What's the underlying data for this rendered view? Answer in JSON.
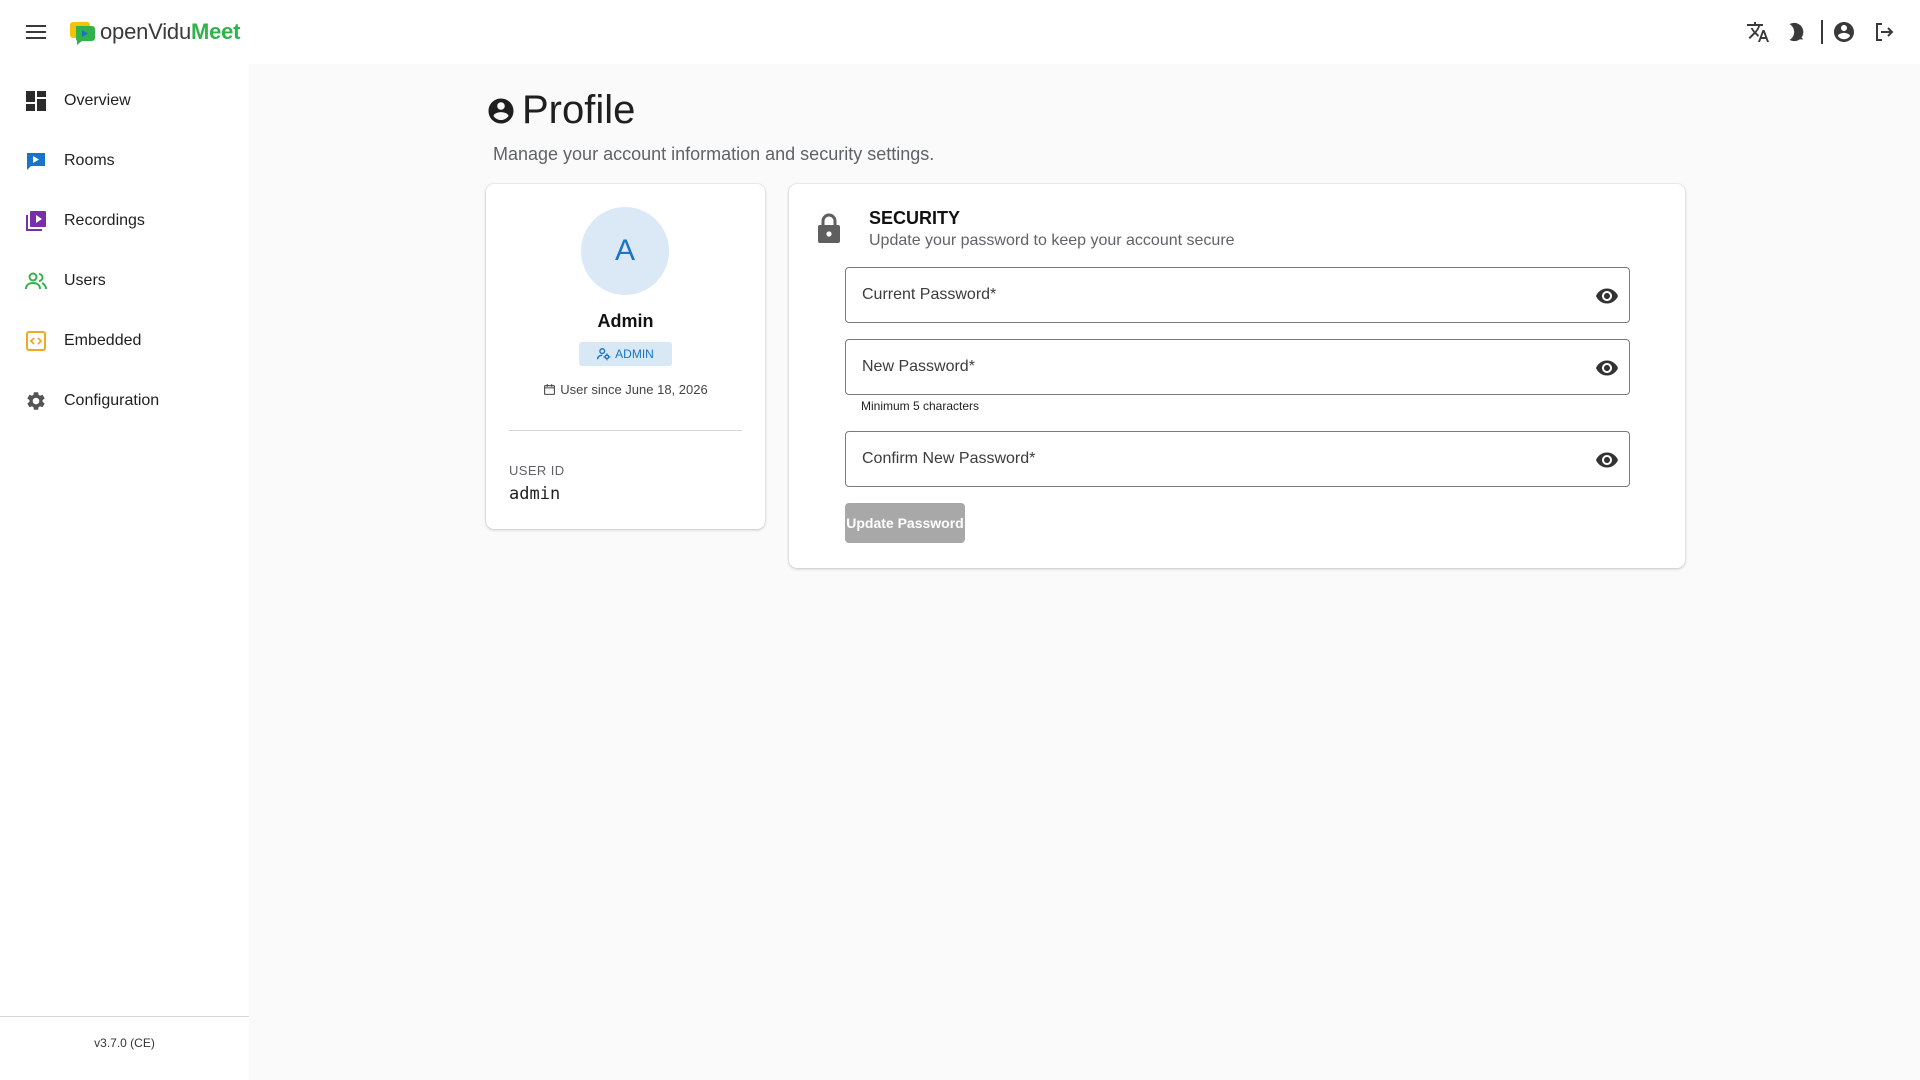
{
  "app": {
    "logo_part1": "openVidu",
    "logo_part2": "Meet",
    "brand_colors": {
      "green": "#31b34a",
      "yellow": "#f4c20d",
      "blue": "#1a73c4"
    }
  },
  "topbar": {
    "icons": [
      "menu-icon",
      "translate-icon",
      "theme-toggle-icon",
      "account-circle-icon",
      "logout-icon"
    ]
  },
  "sidebar": {
    "items": [
      {
        "label": "Overview",
        "icon": "dashboard-icon",
        "color": "#2b2b2b"
      },
      {
        "label": "Rooms",
        "icon": "rooms-icon",
        "color": "#1a73c4"
      },
      {
        "label": "Recordings",
        "icon": "recordings-icon",
        "color": "#7b2fa6"
      },
      {
        "label": "Users",
        "icon": "users-icon",
        "color": "#31b34a"
      },
      {
        "label": "Embedded",
        "icon": "embedded-icon",
        "color": "#f5a623"
      },
      {
        "label": "Configuration",
        "icon": "gear-icon",
        "color": "#555555"
      }
    ],
    "version": "v3.7.0 (CE)"
  },
  "page": {
    "title": "Profile",
    "subtitle": "Manage your account information and security settings."
  },
  "profile": {
    "avatar_initial": "A",
    "name": "Admin",
    "role": "ADMIN",
    "user_since": "User since June 18, 2026",
    "user_id_label": "USER ID",
    "user_id": "admin"
  },
  "security": {
    "title": "SECURITY",
    "subtitle": "Update your password to keep your account secure",
    "current_password_label": "Current Password*",
    "new_password_label": "New Password*",
    "new_password_hint": "Minimum 5 characters",
    "confirm_password_label": "Confirm New Password*",
    "update_button": "Update Password"
  }
}
